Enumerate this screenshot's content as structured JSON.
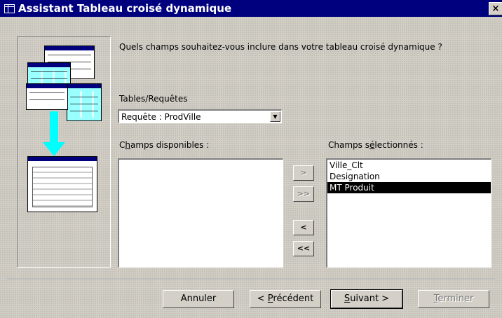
{
  "window": {
    "title": "Assistant Tableau croisé dynamique",
    "close_label": "×"
  },
  "prompt": "Quels champs souhaitez-vous inclure dans votre tableau croisé dynamique ?",
  "tables": {
    "label": "Tables/Requêtes",
    "selected": "Requête : ProdVille"
  },
  "available": {
    "label_prefix": "C",
    "label_ul": "h",
    "label_rest": "amps disponibles :",
    "items": []
  },
  "selected_fields": {
    "label_prefix": "Champs s",
    "label_ul": "é",
    "label_rest": "lectionnés :",
    "items": [
      "Ville_Clt",
      "Designation",
      "MT Produit"
    ],
    "selected_item": "MT Produit"
  },
  "move_buttons": {
    "add_one": ">",
    "add_all": ">>",
    "remove_one": "<",
    "remove_all": "<<"
  },
  "footer": {
    "cancel": "Annuler",
    "previous_prefix": "< ",
    "previous_ul": "P",
    "previous_rest": "récédent",
    "next_ul": "S",
    "next_rest": "uivant >",
    "finish_ul": "T",
    "finish_rest": "erminer"
  },
  "icons": {
    "title": "window-icon",
    "dropdown": "chevron-down-icon"
  },
  "colors": {
    "title_bar": "#00007e",
    "dialog_bg": "#d4d0c8",
    "illustration_accent": "#00ffff"
  }
}
